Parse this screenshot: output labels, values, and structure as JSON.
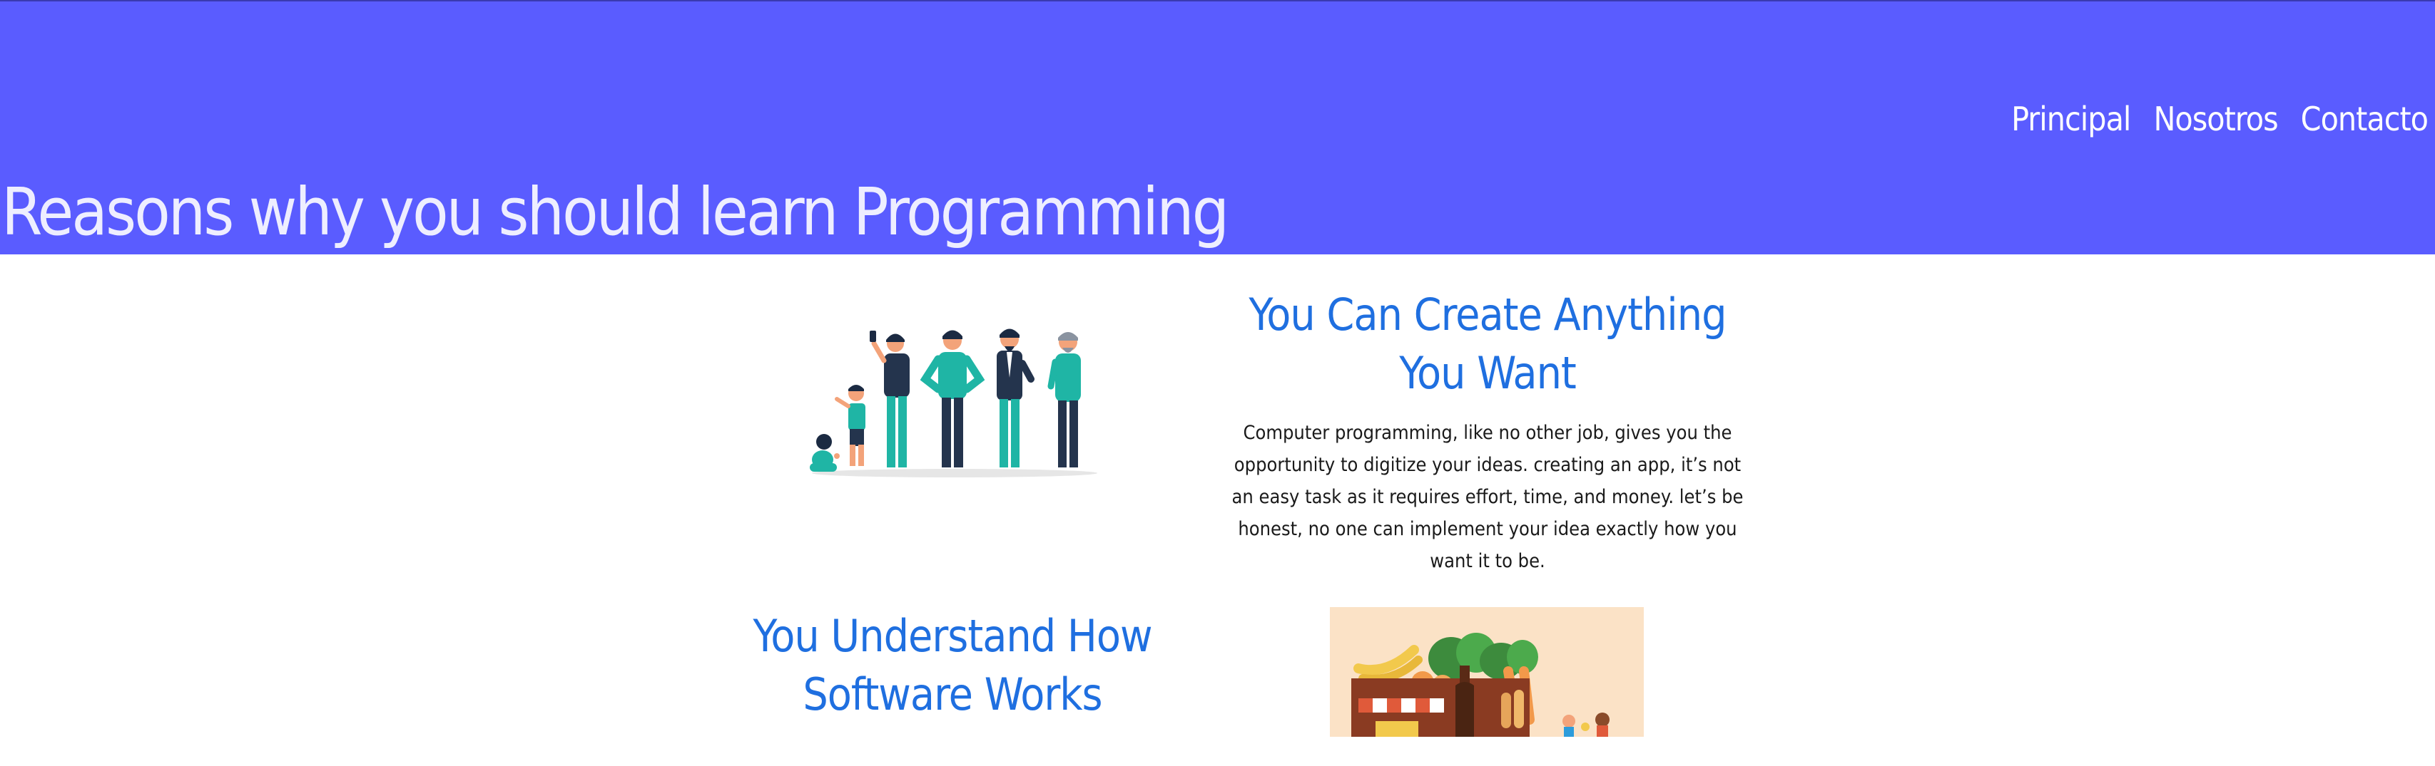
{
  "header": {
    "nav": [
      "Principal",
      "Nosotros",
      "Contacto"
    ],
    "title": "Reasons why you should learn Programming"
  },
  "sections": [
    {
      "title": "You Can Create Anything You Want",
      "text": "Computer programming, like no other job, gives you the opportunity to digitize your ideas. creating an app, it’s not an easy task as it requires effort, time, and money. let’s be honest, no one can implement your idea exactly how you want it to be.",
      "image_icon": "people-growth-illustration"
    },
    {
      "title": "You Understand How Software Works",
      "image_icon": "market-stall-illustration"
    }
  ],
  "colors": {
    "header_bg": "#5a5cff",
    "heading_blue": "#1f6fe0",
    "teal": "#1fb5a5",
    "navy": "#24344d"
  }
}
